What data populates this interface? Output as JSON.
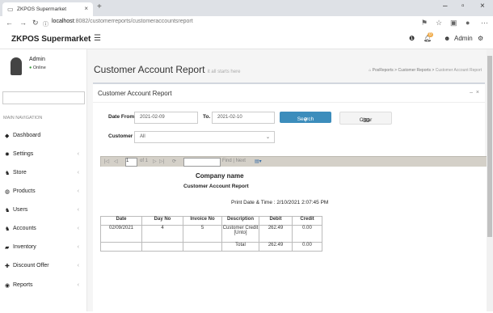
{
  "browser": {
    "tab_title": "ZKPOS Supermarket",
    "tab_close": "×",
    "new_tab": "+",
    "url_host": "localhost",
    "url_path": ":8082/customerreports/customeraccountsreport",
    "min": "–",
    "max": "▫",
    "close": "×"
  },
  "app": {
    "brand": "ZKPOS Supermarket",
    "notif_count": "0",
    "user": "Admin"
  },
  "sidebar": {
    "user_name": "Admin",
    "user_status": "Online",
    "nav_heading": "MAIN NAVIGATION",
    "items": [
      {
        "label": "Dashboard",
        "icon": "dashboard-icon"
      },
      {
        "label": "Settings",
        "icon": "gear-icon"
      },
      {
        "label": "Store",
        "icon": "store-icon"
      },
      {
        "label": "Products",
        "icon": "products-icon"
      },
      {
        "label": "Users",
        "icon": "users-icon"
      },
      {
        "label": "Accounts",
        "icon": "accounts-icon"
      },
      {
        "label": "Inventory",
        "icon": "inventory-icon"
      },
      {
        "label": "Discount Offer",
        "icon": "plus-icon"
      },
      {
        "label": "Reports",
        "icon": "reports-icon"
      }
    ]
  },
  "page": {
    "title": "Customer Account Report",
    "subtitle": "it all starts here",
    "breadcrumb": [
      "PosReports",
      "Customer Reports",
      "Customer Account Report"
    ]
  },
  "panel": {
    "title": "Customer Account Report",
    "date_from_label": "Date From.",
    "date_from_value": "2021-02-09",
    "to_label": "To.",
    "to_value": "2021-02-10",
    "search_label": "Search",
    "clear_label": "Clear",
    "customer_label": "Customer",
    "customer_value": "All"
  },
  "viewer": {
    "page_num": "1",
    "page_of": "of 1",
    "find_label": "Find | Next"
  },
  "report": {
    "company": "Company name",
    "title": "Customer Account Report",
    "print_date": "Print Date & Time : 2/10/2021 2:07:45 PM",
    "columns": [
      "Date",
      "Day No",
      "Invoice No",
      "Description",
      "Debit",
      "Credit"
    ],
    "rows": [
      [
        "02/09/2021",
        "4",
        "5",
        "Customer Credit [Unto]",
        "262.49",
        "0.00"
      ]
    ],
    "total_label": "Total",
    "total_debit": "262.49",
    "total_credit": "0.00"
  }
}
